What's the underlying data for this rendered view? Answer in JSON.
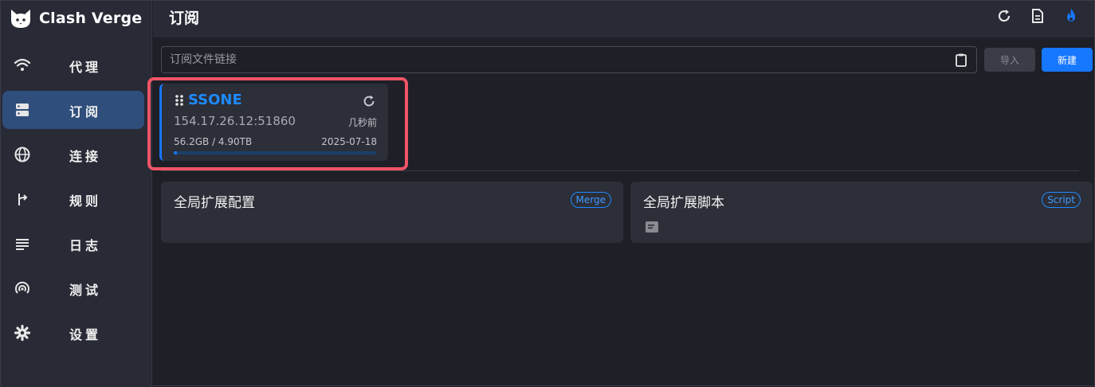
{
  "app": {
    "name": "Clash Verge"
  },
  "sidebar": {
    "items": [
      {
        "label": "代理",
        "icon": "wifi-icon",
        "active": false
      },
      {
        "label": "订阅",
        "icon": "server-icon",
        "active": true
      },
      {
        "label": "连接",
        "icon": "globe-icon",
        "active": false
      },
      {
        "label": "规则",
        "icon": "fork-icon",
        "active": false
      },
      {
        "label": "日志",
        "icon": "list-icon",
        "active": false
      },
      {
        "label": "测试",
        "icon": "radar-icon",
        "active": false
      },
      {
        "label": "设置",
        "icon": "gear-icon",
        "active": false
      }
    ]
  },
  "header": {
    "title": "订阅",
    "actions": [
      "refresh-icon",
      "document-icon",
      "flame-icon"
    ]
  },
  "import": {
    "placeholder": "订阅文件链接",
    "value": "",
    "import_label": "导入",
    "new_label": "新建"
  },
  "profile": {
    "name": "SSONE",
    "host": "154.17.26.12:51860",
    "updated": "几秒前",
    "usage": "56.2GB / 4.90TB",
    "expire": "2025-07-18",
    "usage_fraction": 0.0115
  },
  "extensions": {
    "merge": {
      "title": "全局扩展配置",
      "tag": "Merge"
    },
    "script": {
      "title": "全局扩展脚本",
      "tag": "Script"
    }
  },
  "colors": {
    "accent": "#1677ff",
    "highlight": "#ef5467",
    "background": "#1e1f27",
    "panel": "#282a36",
    "card": "#2c2e38"
  }
}
